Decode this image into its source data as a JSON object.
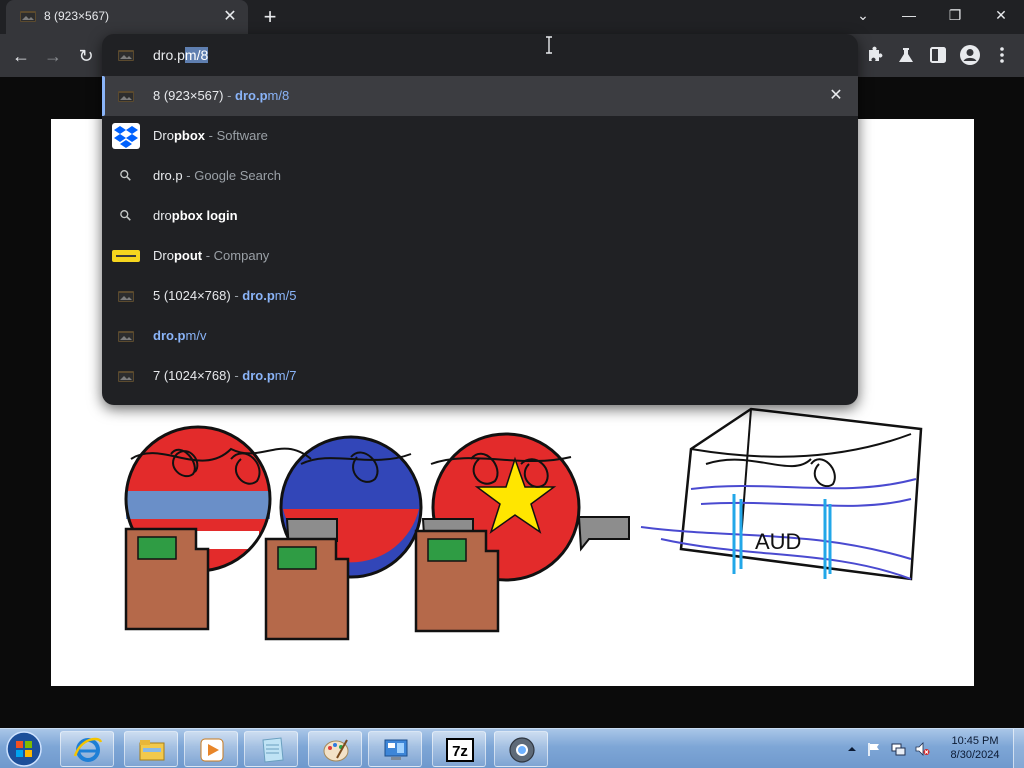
{
  "browser": {
    "tab": {
      "title": "8 (923×567)",
      "close_glyph": "✕"
    },
    "new_tab_glyph": "+",
    "window_controls": {
      "chevron": "⌄",
      "minimize": "—",
      "restore": "❐",
      "close": "✕"
    },
    "nav": {
      "back": "←",
      "forward": "→",
      "reload": "↻"
    },
    "omnibox": {
      "typed": "dro.p",
      "autocomplete": "m/8",
      "suggestions": [
        {
          "kind": "history",
          "title": "8 (923×567)",
          "sep": " - ",
          "url_bold": "dro.p",
          "url_rest": "m/8",
          "selected": true,
          "remove_glyph": "✕"
        },
        {
          "kind": "entity",
          "name_typed": "Dro",
          "name_rest": "pbox",
          "sep": " - ",
          "desc": "Software",
          "icon": "dropbox-logo"
        },
        {
          "kind": "search",
          "query": "dro.p",
          "sep": " - ",
          "desc": "Google Search"
        },
        {
          "kind": "search",
          "typed": "dro",
          "rest": "pbox login"
        },
        {
          "kind": "entity",
          "name_typed": "Dro",
          "name_rest": "pout",
          "sep": " - ",
          "desc": "Company",
          "icon": "dropout-logo"
        },
        {
          "kind": "history",
          "title": "5 (1024×768)",
          "sep": " - ",
          "url_bold": "dro.p",
          "url_rest": "m/5"
        },
        {
          "kind": "url",
          "url_bold": "dro.p",
          "url_rest": "m/v"
        },
        {
          "kind": "history",
          "title": "7 (1024×768)",
          "sep": " - ",
          "url_bold": "dro.p",
          "url_rest": "m/7"
        }
      ]
    }
  },
  "drawing": {
    "box_text": "AUD"
  },
  "taskbar": {
    "apps": [
      "internet-explorer-icon",
      "file-explorer-icon",
      "media-player-icon",
      "notepad-icon",
      "paint-icon",
      "control-panel-icon",
      "7zip-icon",
      "chrome-icon"
    ],
    "sevenzip_label": "7z",
    "clock": {
      "time": "10:45 PM",
      "date": "8/30/2024"
    }
  },
  "colors": {
    "accent": "#8ab4f8",
    "omnibox_bg": "#202124",
    "toolbar_bg": "#35363a",
    "dropbox_blue": "#0061fe",
    "dropout_yellow": "#f5d51e"
  }
}
